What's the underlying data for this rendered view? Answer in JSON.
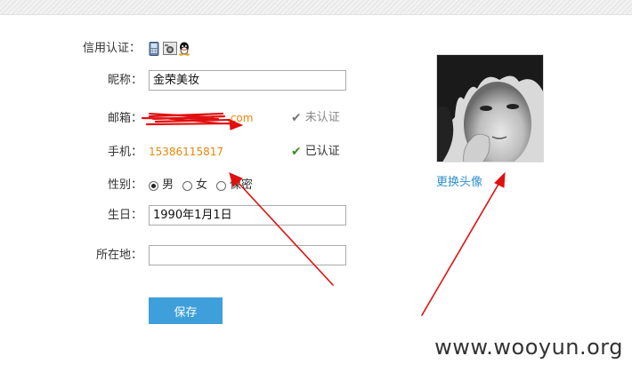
{
  "form": {
    "credit_label": "信用认证：",
    "credit_icons": [
      "phone-icon",
      "camera-icon",
      "qq-icon"
    ],
    "nickname_label": "昵称：",
    "nickname_value": "金荣美妆",
    "email_label": "邮箱：",
    "email_value": ".com",
    "email_status": "未认证",
    "phone_label": "手机：",
    "phone_value": "15386115817",
    "phone_status": "已认证",
    "gender_label": "性别：",
    "gender_options": [
      "男",
      "女",
      "保密"
    ],
    "gender_selected": "男",
    "birthday_label": "生日：",
    "birthday_value": "1990年1月1日",
    "location_label": "所在地：",
    "location_value": "",
    "save_label": "保存"
  },
  "avatar": {
    "change_label": "更换头像"
  },
  "watermark": "www.wooyun.org",
  "colors": {
    "accent_blue": "#3e9fdb",
    "link_blue": "#2f8fd0",
    "orange": "#e8860a",
    "verified_green": "#3a8a2a",
    "unverified_gray": "#888888",
    "arrow_red": "#e01010"
  }
}
